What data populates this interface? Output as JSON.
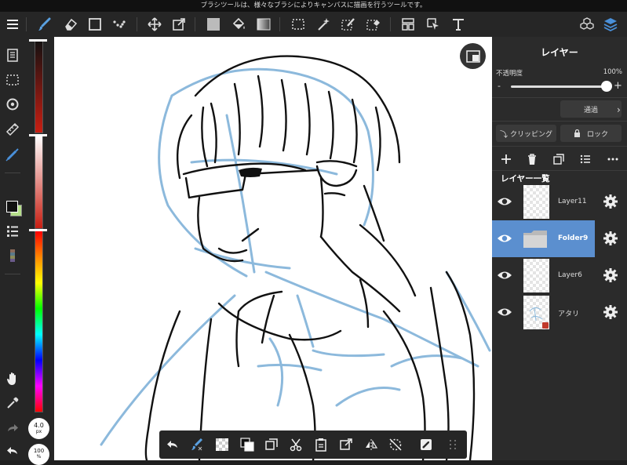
{
  "status_bar": {
    "message": "ブラシツールは、様々なブラシによりキャンバスに描画を行うツールです。"
  },
  "toolbar": {
    "icons": [
      "menu-icon",
      "brush-icon",
      "eraser-icon",
      "shape-icon",
      "dot-brush-icon",
      "move-icon",
      "transform-icon",
      "fill-color-icon",
      "bucket-icon",
      "gradient-icon",
      "select-rect-icon",
      "magic-wand-icon",
      "select-pen-icon",
      "select-eraser-icon",
      "frame-divider-icon",
      "operation-icon",
      "text-icon",
      "material-icon",
      "layers-icon"
    ]
  },
  "brush_size": {
    "value": "4.0",
    "unit": "px"
  },
  "brush_opacity": {
    "value": "100",
    "unit": "%"
  },
  "colors": {
    "accent": "#4a90d9",
    "foreground": "#111111",
    "background": "#b6e08a",
    "selected_layer": "#5b8fcf"
  },
  "layers_panel": {
    "title": "レイヤー",
    "opacity_label": "不透明度",
    "opacity_value": "100%",
    "opacity_fraction": 1.0,
    "minus": "-",
    "plus": "+",
    "blend_mode": "通過",
    "clipping_label": "クリッピング",
    "lock_label": "ロック",
    "list_title": "レイヤー一覧",
    "layers": [
      {
        "name": "Layer11",
        "selected": false,
        "type": "layer"
      },
      {
        "name": "Folder9",
        "selected": true,
        "type": "folder"
      },
      {
        "name": "Layer6",
        "selected": false,
        "type": "layer"
      },
      {
        "name": "アタリ",
        "selected": false,
        "type": "layer"
      }
    ]
  }
}
